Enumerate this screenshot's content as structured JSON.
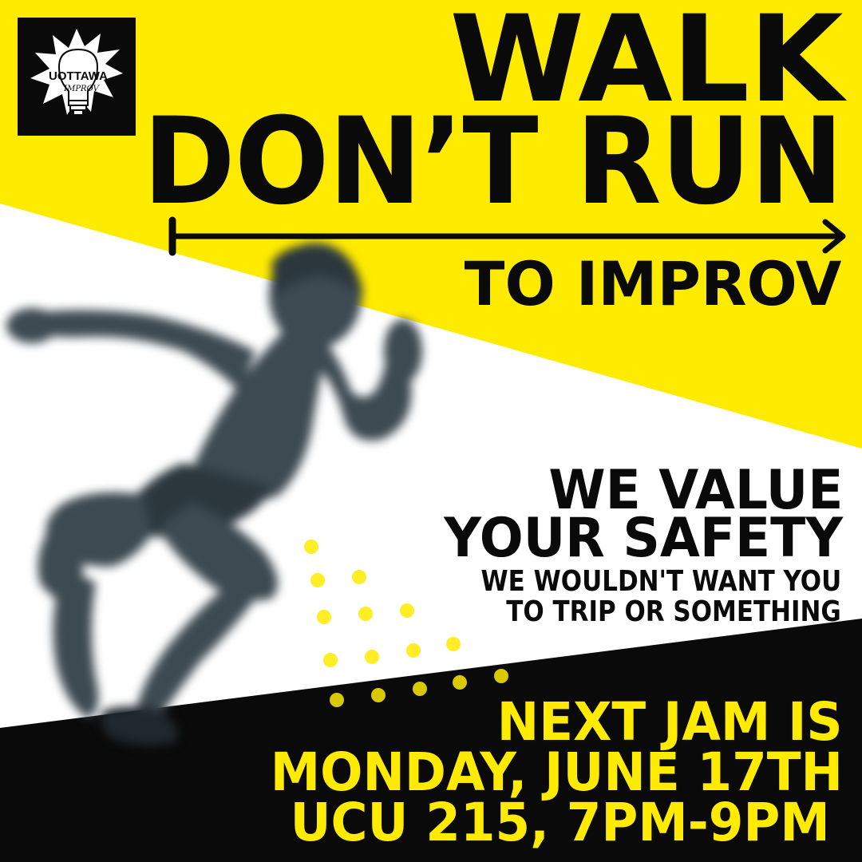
{
  "headline": {
    "line1": "WALK",
    "line2": "DON’T RUN",
    "subline": "TO IMPROV"
  },
  "logo": {
    "name": "uottawa-improv-logo",
    "text_top": "UOTTAWA",
    "text_bottom": "IMPROV"
  },
  "message": {
    "line1": "WE VALUE",
    "line2": "YOUR SAFETY",
    "small1": "WE WOULDN'T WANT YOU",
    "small2": "TO TRIP OR SOMETHING"
  },
  "event": {
    "line1": "NEXT JAM IS",
    "line2": "MONDAY, JUNE 17TH",
    "line3": "UCU 215, 7PM-9PM"
  },
  "colors": {
    "yellow": "#ffeb00",
    "black": "#0a0a0a",
    "white": "#ffffff",
    "runner": "#3d4a52"
  },
  "icons": [
    "arrow-right-icon",
    "lightbulb-icon"
  ]
}
